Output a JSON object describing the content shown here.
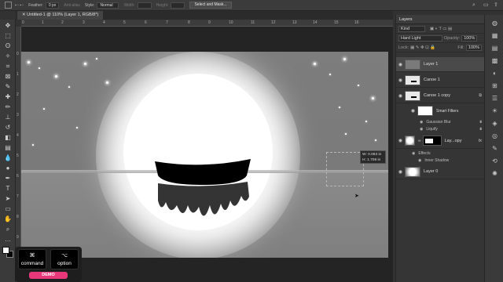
{
  "options_bar": {
    "feather_label": "Feather:",
    "feather_value": "0 px",
    "anti_alias": "Anti-alias",
    "style_label": "Style:",
    "style_value": "Normal",
    "width_label": "Width:",
    "height_label": "Height:",
    "select_mask_button": "Select and Mask..."
  },
  "document_tab": {
    "title": "Untitled-1 @ 110% (Layer 1, RGB/8*)"
  },
  "ruler": {
    "horizontal": [
      "0",
      "1",
      "2",
      "3",
      "4",
      "5",
      "6",
      "7",
      "8",
      "9",
      "10",
      "11",
      "12",
      "13",
      "14",
      "15",
      "16"
    ],
    "vertical": [
      "0",
      "1",
      "2",
      "3",
      "4",
      "5",
      "6",
      "7",
      "8",
      "9"
    ]
  },
  "canvas": {
    "readout_width": "W: 0.083 in",
    "readout_height": "H: 1.708 in"
  },
  "layers_panel": {
    "title": "Layers",
    "filter_kind": "Kind",
    "blend_mode": "Hard Light",
    "opacity_label": "Opacity:",
    "opacity_value": "100%",
    "lock_label": "Lock:",
    "fill_label": "Fill:",
    "fill_value": "100%",
    "layers": [
      {
        "name": "Layer 1"
      },
      {
        "name": "Canoe 1"
      },
      {
        "name": "Canoe 1 copy"
      },
      {
        "name": "Smart Filters"
      },
      {
        "name": "Gaussian Blur"
      },
      {
        "name": "Liquify"
      },
      {
        "name": "Lay...opy"
      },
      {
        "name": "Effects"
      },
      {
        "name": "Inner Shadow"
      },
      {
        "name": "Layer 0"
      }
    ],
    "fx_label": "fx"
  },
  "keystrokes": [
    {
      "symbol": "⌘",
      "name": "command"
    },
    {
      "symbol": "⌥",
      "name": "option"
    }
  ],
  "demo_badge": "DEMO"
}
